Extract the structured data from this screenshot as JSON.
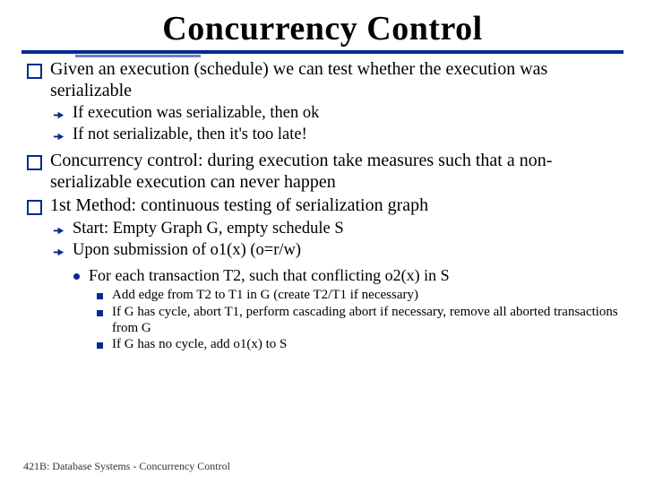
{
  "title": "Concurrency Control",
  "b1": "Given an execution (schedule) we can test whether the execution was serializable",
  "b1a": "If execution was serializable, then ok",
  "b1b": "If not serializable, then it's too late!",
  "b2": "Concurrency control: during execution take measures such that a non-serializable execution can never happen",
  "b3": "1st Method: continuous testing of serialization graph",
  "b3a": "Start: Empty Graph G, empty schedule S",
  "b3b": "Upon submission of o1(x) (o=r/w)",
  "b3b1": "For each transaction T2, such that conflicting o2(x) in S",
  "b3b1a": "Add  edge from T2 to T1 in G (create T2/T1 if necessary)",
  "b3b1b": "If G has cycle, abort T1, perform cascading abort if necessary, remove all aborted transactions from G",
  "b3b1c": "If G has no cycle, add o1(x) to S",
  "footer": "421B: Database Systems - Concurrency Control"
}
